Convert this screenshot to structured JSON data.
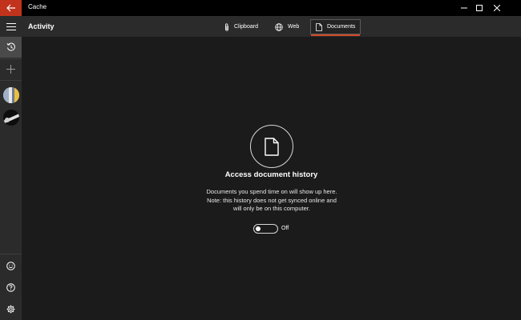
{
  "window": {
    "title": "Cache"
  },
  "header": {
    "title": "Activity",
    "tabs": [
      {
        "label": "Clipboard",
        "icon": "paperclip-icon",
        "selected": false
      },
      {
        "label": "Web",
        "icon": "globe-icon",
        "selected": false
      },
      {
        "label": "Documents",
        "icon": "document-icon",
        "selected": true
      }
    ]
  },
  "sidebar": {
    "items": [
      {
        "icon": "hamburger-menu-icon"
      },
      {
        "icon": "history-icon",
        "active": true
      },
      {
        "icon": "plus-icon"
      },
      {
        "icon": "avatar-1"
      },
      {
        "icon": "avatar-2"
      }
    ],
    "footer": [
      {
        "icon": "smiley-icon"
      },
      {
        "icon": "help-icon"
      },
      {
        "icon": "gear-icon"
      }
    ]
  },
  "main": {
    "icon": "document-icon",
    "heading": "Access document history",
    "description": "Documents you spend time on will show up here. Note: this history does not get synced online and will only be on this computer.",
    "toggle": {
      "state": "off",
      "label": "Off"
    }
  },
  "colors": {
    "accent": "#c1331c",
    "tab_underline": "#d04b27",
    "background": "#1b1b1b",
    "rail": "#2b2b2b",
    "titlebar": "#000000"
  }
}
